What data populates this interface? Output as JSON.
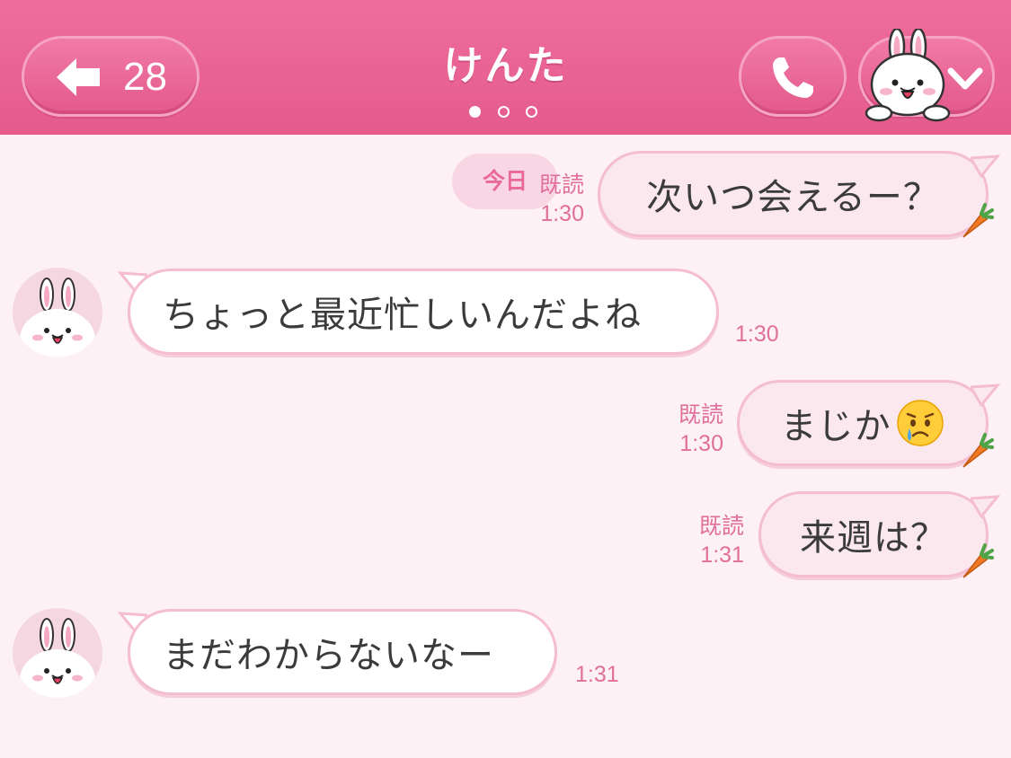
{
  "header": {
    "back_count": "28",
    "title": "けんた",
    "page_dots": 3,
    "active_dot": 0
  },
  "chat": {
    "date_label": "今日",
    "messages": [
      {
        "side": "mine",
        "text": "次いつ会えるー？",
        "read": "既読",
        "time": "1:30"
      },
      {
        "side": "theirs",
        "text": "ちょっと最近忙しいんだよね",
        "time": "1:30"
      },
      {
        "side": "mine",
        "text": "まじか",
        "emoji": "crying-face",
        "read": "既読",
        "time": "1:30"
      },
      {
        "side": "mine",
        "text": "来週は？",
        "read": "既読",
        "time": "1:31"
      },
      {
        "side": "theirs",
        "text": "まだわからないなー",
        "time": "1:31"
      }
    ]
  },
  "icons": {
    "back": "back-arrow-icon",
    "call": "phone-icon",
    "menu": "chevron-down-icon",
    "avatar": "bunny-avatar-icon",
    "decoration": "carrot-icon"
  },
  "colors": {
    "header": "#e8628f",
    "background": "#fdf1f5",
    "bubble_mine": "#fbe7ee",
    "bubble_theirs": "#ffffff",
    "bubble_border": "#f4bdd1",
    "meta_text": "#e0709a"
  }
}
